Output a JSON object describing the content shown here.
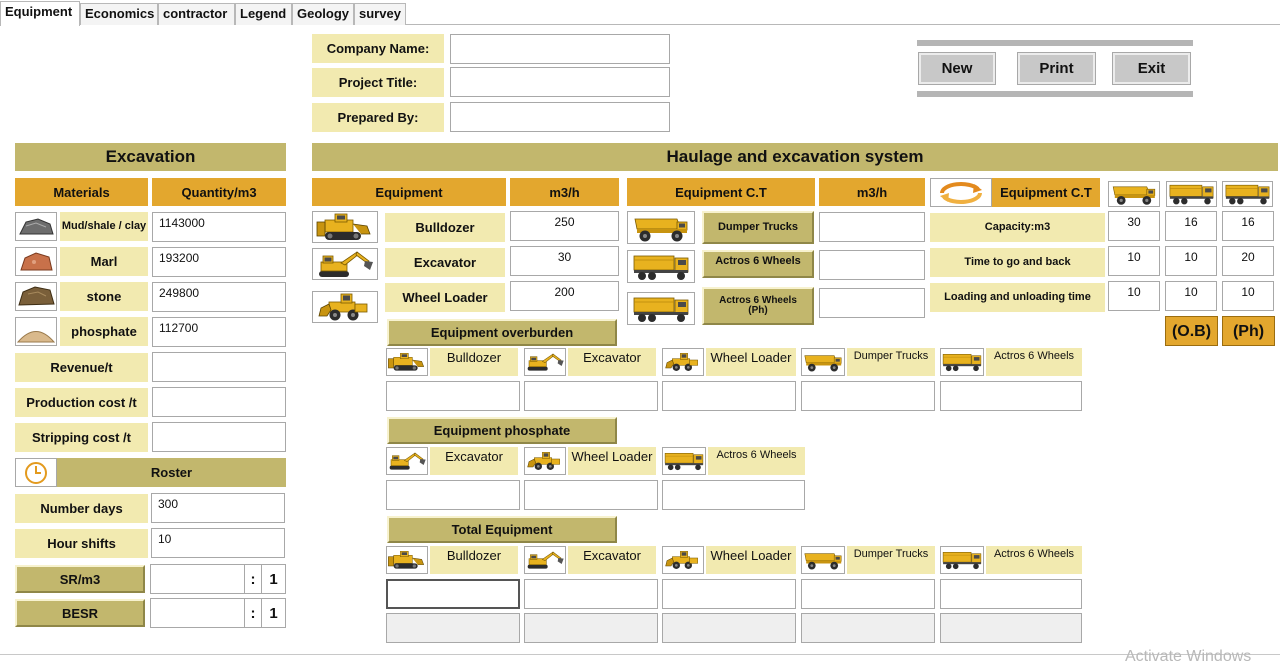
{
  "tabs": [
    "Equipment",
    "Economics",
    "contractor",
    "Legend",
    "Geology",
    "survey"
  ],
  "header": {
    "company_label": "Company Name:",
    "company_value": "",
    "project_label": "Project Title:",
    "project_value": "",
    "prepared_label": "Prepared By:",
    "prepared_value": ""
  },
  "buttons": {
    "new": "New",
    "print": "Print",
    "exit": "Exit"
  },
  "excavation": {
    "title": "Excavation",
    "materials_header": "Materials",
    "quantity_header": "Quantity/m3",
    "rows": [
      {
        "label": "Mud/shale / clay",
        "value": "1143000",
        "icon": "mud-rock-icon"
      },
      {
        "label": "Marl",
        "value": "193200",
        "icon": "marl-rock-icon"
      },
      {
        "label": "stone",
        "value": "249800",
        "icon": "stone-icon"
      },
      {
        "label": "phosphate",
        "value": "112700",
        "icon": "phosphate-pile-icon"
      }
    ],
    "revenue_label": "Revenue/t",
    "revenue_value": "",
    "production_label": "Production cost /t",
    "production_value": "",
    "stripping_label": "Stripping cost /t",
    "stripping_value": "",
    "roster_label": "Roster",
    "days_label": "Number days",
    "days_value": "300",
    "shifts_label": "Hour shifts",
    "shifts_value": "10",
    "sr_label": "SR/m3",
    "sr_value": "",
    "sr_colon": ":",
    "sr_ratio": "1",
    "besr_label": "BESR",
    "besr_value": "",
    "besr_colon": ":",
    "besr_ratio": "1"
  },
  "haulage": {
    "title": "Haulage and excavation system",
    "equipment_header": "Equipment",
    "m3h_header": "m3/h",
    "ct_header": "Equipment C.T",
    "m3h_header2": "m3/h",
    "ct_header2": "Equipment C.T",
    "equipment": [
      {
        "label": "Bulldozer",
        "value": "250"
      },
      {
        "label": "Excavator",
        "value": "30"
      },
      {
        "label": "Wheel Loader",
        "value": "200"
      }
    ],
    "trucks": [
      {
        "label": "Dumper Trucks",
        "value": ""
      },
      {
        "label": "Actros 6 Wheels",
        "value": ""
      },
      {
        "label": "Actros 6 Wheels (Ph)",
        "value": ""
      }
    ],
    "params": [
      {
        "label": "Capacity:m3",
        "values": [
          "30",
          "16",
          "16"
        ]
      },
      {
        "label": "Time to go and back",
        "values": [
          "10",
          "10",
          "20"
        ]
      },
      {
        "label": "Loading and unloading time",
        "values": [
          "10",
          "10",
          "10"
        ]
      }
    ],
    "ob_label": "(O.B)",
    "ph_label": "(Ph)"
  },
  "overburden": {
    "title": "Equipment overburden",
    "items": [
      "Bulldozer",
      "Excavator",
      "Wheel Loader",
      "Dumper Trucks",
      "Actros 6 Wheels"
    ],
    "values": [
      "",
      "",
      "",
      "",
      ""
    ]
  },
  "phosphate": {
    "title": "Equipment phosphate",
    "items": [
      "Excavator",
      "Wheel Loader",
      "Actros 6 Wheels"
    ],
    "values": [
      "",
      "",
      ""
    ]
  },
  "total": {
    "title": "Total Equipment",
    "items": [
      "Bulldozer",
      "Excavator",
      "Wheel Loader",
      "Dumper Trucks",
      "Actros 6 Wheels"
    ],
    "values": [
      "",
      "",
      "",
      "",
      ""
    ],
    "values2": [
      "",
      "",
      "",
      "",
      ""
    ]
  },
  "watermark": "Activate Windows",
  "colors": {
    "olive": "#c2b76d",
    "cream": "#f2eab0",
    "gold": "#e3a72e",
    "machine_yellow": "#e8b21f"
  }
}
